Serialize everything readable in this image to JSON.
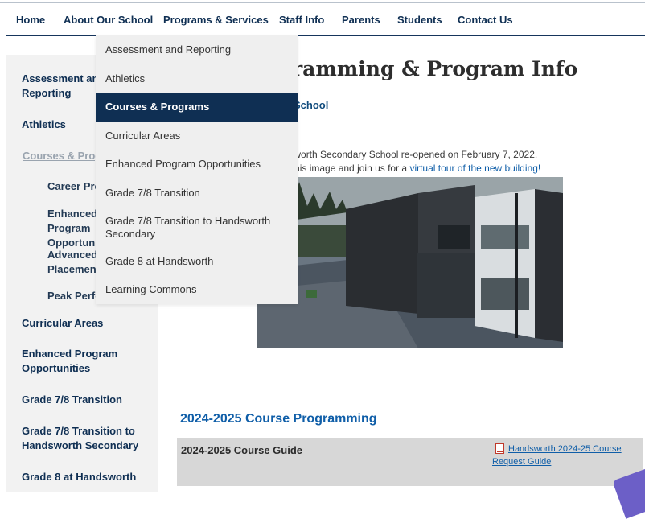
{
  "topnav": {
    "items": [
      "Home",
      "About Our School",
      "Programs & Services",
      "Staff Info",
      "Parents",
      "Students",
      "Contact Us"
    ]
  },
  "sidebar": {
    "items": [
      {
        "label": "Assessment and Reporting"
      },
      {
        "label": "Athletics"
      },
      {
        "label": "Courses & Programs"
      },
      {
        "label": "Career Programs"
      },
      {
        "label": "Enhanced Program Opportunities"
      },
      {
        "label": "Advanced Placement"
      },
      {
        "label": "Peak Performance"
      },
      {
        "label": "Curricular Areas"
      },
      {
        "label": "Enhanced Program Opportunities"
      },
      {
        "label": "Grade 7/8 Transition"
      },
      {
        "label": "Grade 7/8 Transition to Handsworth Secondary"
      },
      {
        "label": "Grade 8 at Handsworth"
      }
    ]
  },
  "main": {
    "heading": "ramming & Program Info",
    "school_label": "School",
    "description_line1": "ndsworth Secondary School re-opened on February 7, 2022.",
    "description_line2_prefix": "on this image and join us for a ",
    "description_line2_link": "virtual tour of the new building!",
    "section_heading": "2024-2025 Course Programming",
    "guide_title": "2024-2025 Course Guide",
    "guide_link": "Handsworth 2024-25 Course Request Guide"
  },
  "dropdown": {
    "items": [
      "Assessment and Reporting",
      "Athletics",
      "Courses & Programs",
      "Curricular Areas",
      "Enhanced Program Opportunities",
      "Grade 7/8 Transition",
      "Grade 7/8 Transition to Handsworth Secondary",
      "Grade 8 at Handsworth",
      "Learning Commons"
    ]
  },
  "colors": {
    "navy": "#0f2f53",
    "link_blue": "#0f5ea8",
    "sidebar_bg": "#f2f2f2",
    "dropdown_bg": "#efefef",
    "dropdown_active": "#0f2f53"
  },
  "icons": {
    "guide_file": "pdf-file-icon"
  }
}
